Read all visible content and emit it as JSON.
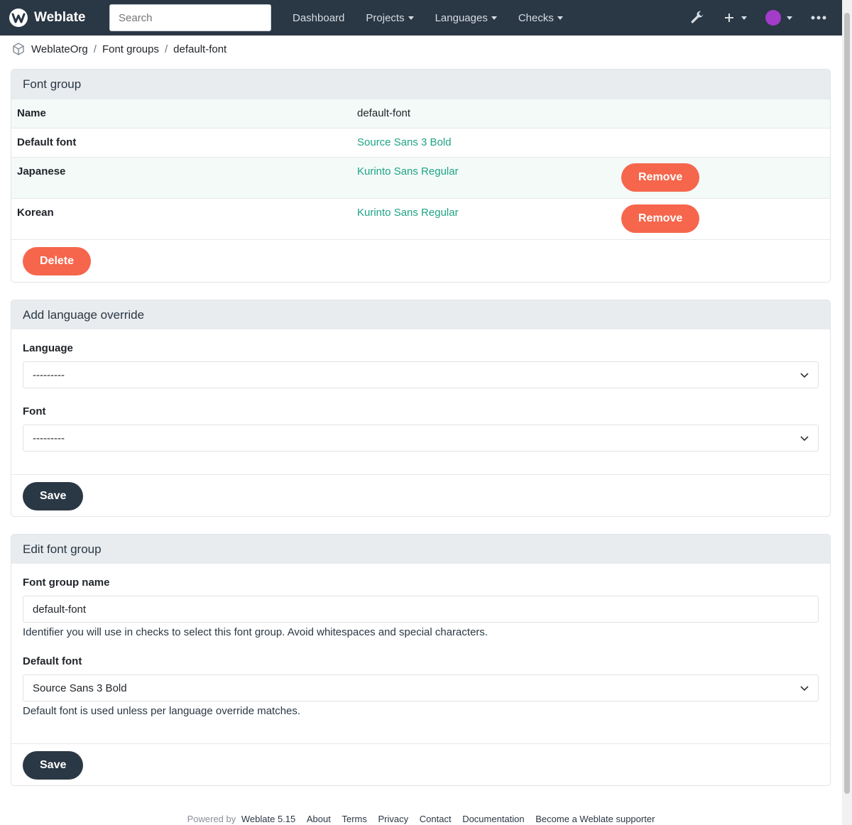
{
  "navbar": {
    "brand": "Weblate",
    "search_placeholder": "Search",
    "links": [
      "Dashboard",
      "Projects",
      "Languages",
      "Checks"
    ],
    "icons": [
      "wrench-icon",
      "plus-icon",
      "avatar",
      "more-icon"
    ]
  },
  "breadcrumb": [
    "WeblateOrg",
    "Font groups",
    "default-font"
  ],
  "font_group": {
    "title": "Font group",
    "rows": [
      {
        "label": "Name",
        "value": "default-font"
      },
      {
        "label": "Default font",
        "value": "Source Sans 3 Bold"
      },
      {
        "label": "Japanese",
        "value": "Kurinto Sans Regular",
        "action": "Remove"
      },
      {
        "label": "Korean",
        "value": "Kurinto Sans Regular",
        "action": "Remove"
      }
    ],
    "delete_label": "Delete"
  },
  "override": {
    "title": "Add language override",
    "language_label": "Language",
    "language_value": "---------",
    "font_label": "Font",
    "font_value": "---------",
    "save_label": "Save"
  },
  "edit": {
    "title": "Edit font group",
    "name_label": "Font group name",
    "name_value": "default-font",
    "name_help": "Identifier you will use in checks to select this font group. Avoid whitespaces and special characters.",
    "default_font_label": "Default font",
    "default_font_value": "Source Sans 3 Bold",
    "default_font_help": "Default font is used unless per language override matches.",
    "save_label": "Save"
  },
  "footer": {
    "powered_by": "Powered by",
    "links": [
      "Weblate 5.15",
      "About",
      "Terms",
      "Privacy",
      "Contact",
      "Documentation",
      "Become a Weblate supporter"
    ]
  },
  "colors": {
    "navbar": "#2a3744",
    "accent": "#1fa385",
    "danger": "#f6664c"
  }
}
